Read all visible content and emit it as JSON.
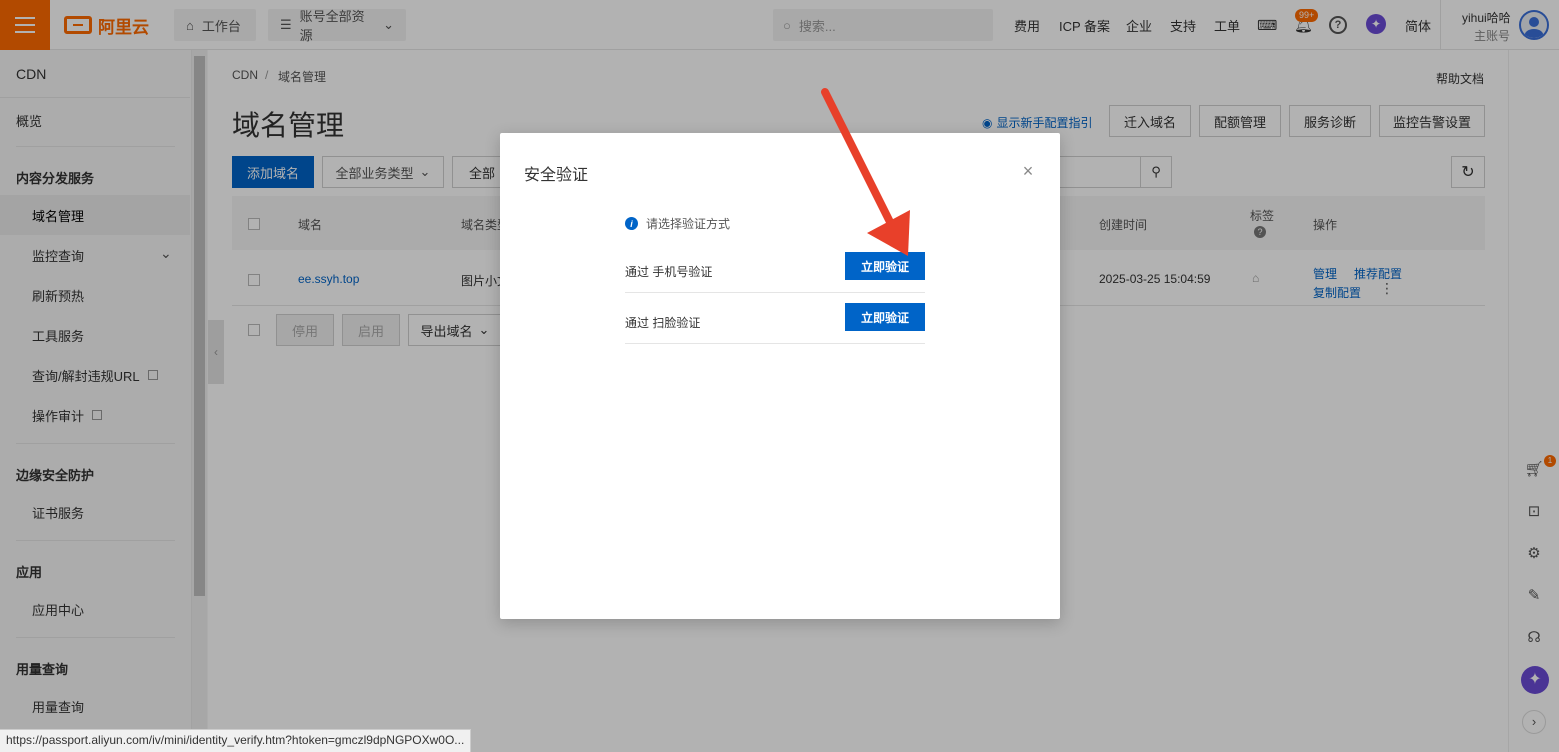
{
  "topbar": {
    "logo_text": "阿里云",
    "workbench_label": "工作台",
    "resources_label": "账号全部资源",
    "search_placeholder": "搜索...",
    "nav": [
      "费用",
      "ICP 备案",
      "企业",
      "支持",
      "工单"
    ],
    "notification_badge": "99+",
    "lang_label": "简体",
    "user_name": "yihui哈哈",
    "user_role": "主账号"
  },
  "sidebar": {
    "title": "CDN",
    "overview": "概览",
    "sections": {
      "content_delivery": "内容分发服务",
      "edge_security": "边缘安全防护",
      "apps": "应用",
      "usage": "用量查询"
    },
    "items": {
      "domain_mgmt": "域名管理",
      "monitoring": "监控查询",
      "refresh": "刷新预热",
      "tools": "工具服务",
      "query_url": "查询/解封违规URL",
      "audit": "操作审计",
      "cert": "证书服务",
      "app_center": "应用中心",
      "usage_query": "用量查询"
    }
  },
  "main": {
    "breadcrumb_root": "CDN",
    "breadcrumb_sep": "/",
    "breadcrumb_current": "域名管理",
    "help_doc": "帮助文档",
    "page_title": "域名管理",
    "guide_link": "显示新手配置指引",
    "buttons": {
      "migrate": "迁入域名",
      "quota": "配额管理",
      "diagnose": "服务诊断",
      "alert": "监控告警设置",
      "add_domain": "添加域名",
      "biz_type": "全部业务类型",
      "all_prefix": "全部",
      "disable": "停用",
      "enable": "启用",
      "export": "导出域名"
    },
    "table": {
      "headers": {
        "domain": "域名",
        "domain_type": "域名类型",
        "created": "创建时间",
        "tag": "标签",
        "actions": "操作"
      },
      "rows": [
        {
          "domain": "ee.ssyh.top",
          "type": "图片小文",
          "created": "2025-03-25 15:04:59",
          "actions": [
            "管理",
            "推荐配置",
            "复制配置"
          ]
        }
      ]
    }
  },
  "modal": {
    "title": "安全验证",
    "info": "请选择验证方式",
    "options": [
      {
        "label": "通过 手机号验证",
        "button": "立即验证"
      },
      {
        "label": "通过 扫脸验证",
        "button": "立即验证"
      }
    ]
  },
  "rail": {
    "cart_badge": "1"
  },
  "status_url": "https://passport.aliyun.com/iv/mini/identity_verify.htm?htoken=gmczl9dpNGPOXw0O...",
  "colors": {
    "brand": "#ff6a00",
    "primary": "#0064c8",
    "arrow": "#e8402a"
  }
}
